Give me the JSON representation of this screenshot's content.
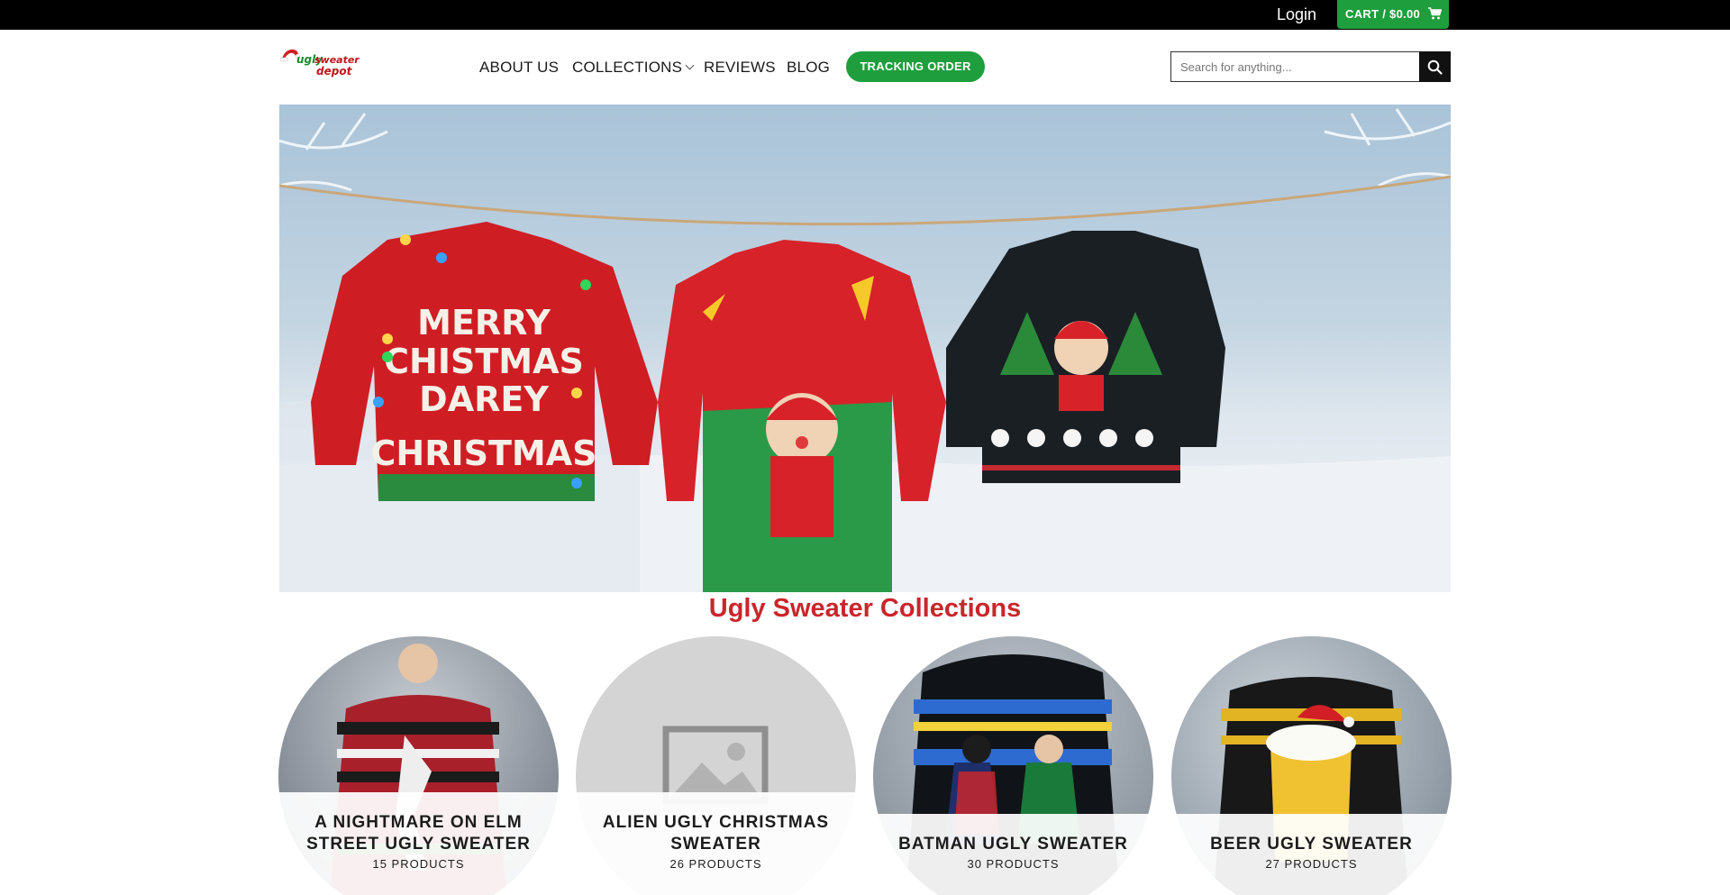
{
  "topbar": {
    "login_label": "Login",
    "cart_label": "CART / $0.00",
    "cart_icon": "shopping-cart-icon"
  },
  "header": {
    "logo_words": [
      "ugly",
      "sweater",
      "depot"
    ],
    "nav": [
      {
        "label": "ABOUT US"
      },
      {
        "label": "COLLECTIONS",
        "has_dropdown": true
      },
      {
        "label": "REVIEWS"
      },
      {
        "label": "BLOG"
      }
    ],
    "tracking_button": "TRACKING ORDER",
    "search": {
      "placeholder": "Search for anything...",
      "value": "",
      "icon": "search-icon"
    }
  },
  "hero": {
    "sweater_text": [
      "MERRY",
      "CHISTMAS",
      "DAREY",
      "CHRISTMAS"
    ]
  },
  "collections": {
    "title": "Ugly Sweater Collections",
    "items": [
      {
        "name": "A NIGHTMARE ON ELM STREET UGLY SWEATER",
        "name_lines": [
          "A NIGHTMARE ON ELM",
          "STREET UGLY SWEATER"
        ],
        "count": "15 PRODUCTS"
      },
      {
        "name": "ALIEN UGLY CHRISTMAS SWEATER",
        "name_lines": [
          "ALIEN UGLY CHRISTMAS",
          "SWEATER"
        ],
        "count": "26 PRODUCTS"
      },
      {
        "name": "BATMAN UGLY SWEATER",
        "name_lines": [
          "BATMAN UGLY SWEATER"
        ],
        "count": "30 PRODUCTS"
      },
      {
        "name": "BEER UGLY SWEATER",
        "name_lines": [
          "BEER UGLY SWEATER"
        ],
        "count": "27 PRODUCTS"
      }
    ]
  },
  "colors": {
    "accent_green": "#1e9e3c",
    "title_red": "#c9262c",
    "topbar_black": "#000000"
  }
}
